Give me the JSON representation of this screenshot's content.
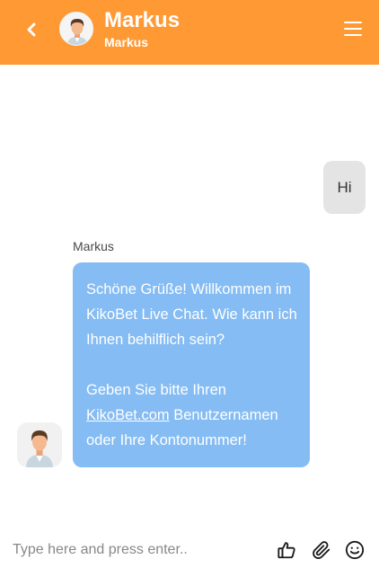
{
  "header": {
    "title": "Markus",
    "subtitle": "Markus",
    "back_icon": "chevron-left-icon",
    "menu_icon": "hamburger-menu-icon",
    "background_color": "#FF9933"
  },
  "messages": {
    "user_message": "Hi",
    "agent_name": "Markus",
    "agent_text_1": "Schöne Grüße! Willkommen im KikoBet Live Chat. Wie kann ich Ihnen behilflich sein?",
    "agent_text_2_before": "Geben Sie bitte Ihren ",
    "agent_text_2_link": "KikoBet.com",
    "agent_text_2_after": " Benutzernamen oder Ihre Kontonummer!",
    "agent_bubble_color": "#85BCF3",
    "user_bubble_color": "#E4E4E4"
  },
  "composer": {
    "placeholder": "Type here and press enter..",
    "value": "",
    "icons": [
      "thumbs-up-icon",
      "paperclip-icon",
      "smiley-icon"
    ]
  }
}
